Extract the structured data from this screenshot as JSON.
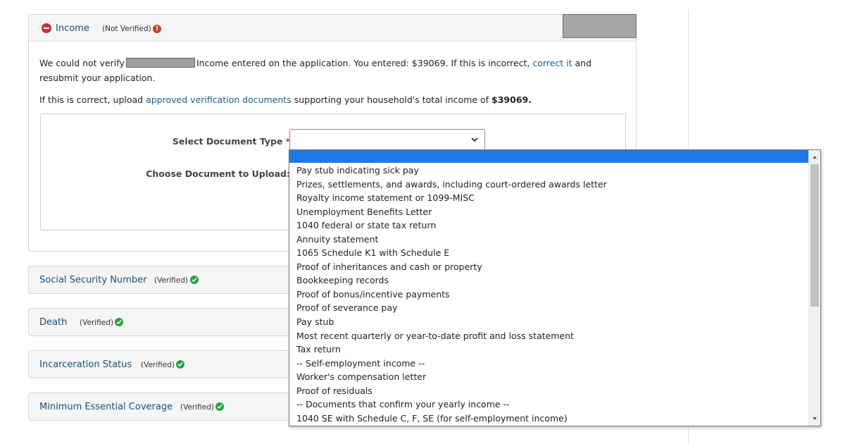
{
  "income_panel": {
    "title": "Income",
    "status": "(Not Verified)",
    "status_icon": "exclamation-icon",
    "msg1_before": "We could not verify",
    "msg1_after": "Income entered on the application. You entered: $39069. If this is incorrect,",
    "msg1_link": "correct it",
    "msg1_end": "and resubmit your application.",
    "msg2_before": "If this is correct, upload",
    "msg2_link": "approved verification documents",
    "msg2_middle": "supporting your household's total income of",
    "msg2_amount": "$39069.",
    "select_label": "Select Document Type",
    "required_mark": "*",
    "choose_label": "Choose Document to Upload:",
    "select_value": ""
  },
  "sections": [
    {
      "title": "Social Security Number",
      "status": "(Verified)"
    },
    {
      "title": "Death",
      "status": "(Verified)"
    },
    {
      "title": "Incarceration Status",
      "status": "(Verified)"
    },
    {
      "title": "Minimum Essential Coverage",
      "status": "(Verified)"
    }
  ],
  "dropdown": {
    "selected": "",
    "options": [
      "Pay stub indicating sick pay",
      "Prizes, settlements, and awards, including court-ordered awards letter",
      "Royalty income statement or 1099-MISC",
      "Unemployment Benefits Letter",
      "1040 federal or state tax return",
      "Annuity statement",
      "1065 Schedule K1 with Schedule E",
      "Proof of inheritances and cash or property",
      "Bookkeeping records",
      "Proof of bonus/incentive payments",
      "Proof of severance pay",
      "Pay stub",
      "Most recent quarterly or year-to-date profit and loss statement",
      "Tax return",
      "-- Self-employment income --",
      "Worker's compensation letter",
      "Proof of residuals",
      "-- Documents that confirm your yearly income --",
      "1040 SE with Schedule C, F, SE (for self-employment income)"
    ]
  },
  "colors": {
    "link": "#1b5e8a",
    "not_verified": "#c9302c",
    "verified": "#2e9e4a",
    "highlight": "#1e78e6"
  }
}
